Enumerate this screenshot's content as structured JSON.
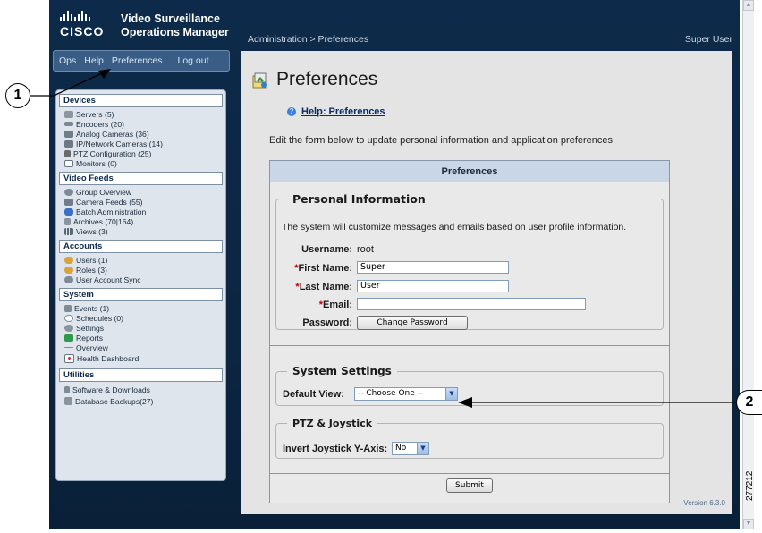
{
  "header": {
    "brand_word": "CISCO",
    "app_title_line1": "Video Surveillance",
    "app_title_line2": "Operations Manager",
    "breadcrumb": "Administration > Preferences",
    "user": "Super User"
  },
  "topnav": [
    "Ops",
    "Help",
    "Preferences",
    "Log out"
  ],
  "sidebar": {
    "sections": [
      {
        "title": "Devices",
        "items": [
          {
            "label": "Servers (5)",
            "icon": "server-icon",
            "color": "#8c96a3"
          },
          {
            "label": "Encoders (20)",
            "icon": "encoder-icon",
            "color": "#7d8894"
          },
          {
            "label": "Analog Cameras (36)",
            "icon": "analog-camera-icon",
            "color": "#6f7c8a"
          },
          {
            "label": "IP/Network Cameras (14)",
            "icon": "ip-camera-icon",
            "color": "#6c7886"
          },
          {
            "label": "PTZ Configuration (25)",
            "icon": "ptz-icon",
            "color": "#6a6a6a"
          },
          {
            "label": "Monitors (0)",
            "icon": "monitor-icon",
            "color": "#8e98a5"
          }
        ]
      },
      {
        "title": "Video Feeds",
        "items": [
          {
            "label": "Group Overview",
            "icon": "group-overview-icon",
            "color": "#7f8a98"
          },
          {
            "label": "Camera Feeds (55)",
            "icon": "camera-feeds-icon",
            "color": "#707c8a"
          },
          {
            "label": "Batch Administration",
            "icon": "batch-icon",
            "color": "#3a6fc8"
          },
          {
            "label": "Archives (70|164)",
            "icon": "archive-icon",
            "color": "#8a94a0"
          },
          {
            "label": "Views (3)",
            "icon": "views-icon",
            "color": "#8a94a0"
          }
        ]
      },
      {
        "title": "Accounts",
        "items": [
          {
            "label": "Users (1)",
            "icon": "users-icon",
            "color": "#d9a23a"
          },
          {
            "label": "Roles (3)",
            "icon": "roles-icon",
            "color": "#d9a23a"
          },
          {
            "label": "User Account Sync",
            "icon": "account-sync-icon",
            "color": "#7f8a98"
          }
        ]
      },
      {
        "title": "System",
        "items": [
          {
            "label": "Events (1)",
            "icon": "events-icon",
            "color": "#7f8a98"
          },
          {
            "label": "Schedules (0)",
            "icon": "schedules-icon",
            "color": "#8a94a0"
          },
          {
            "label": "Settings",
            "icon": "settings-icon",
            "color": "#8a94a0"
          },
          {
            "label": "Reports",
            "icon": "reports-icon",
            "color": "#2f9a4a"
          },
          {
            "label": "Overview",
            "icon": "overview-icon",
            "color": "#9aa3ae"
          },
          {
            "label": "Health Dashboard",
            "icon": "health-icon",
            "color": "#c83a3a"
          }
        ]
      },
      {
        "title": "Utilities",
        "items": [
          {
            "label": "Software & Downloads",
            "icon": "download-icon",
            "color": "#7f8a98"
          },
          {
            "label": "Database Backups(27)",
            "icon": "backup-icon",
            "color": "#8a94a0"
          }
        ]
      }
    ]
  },
  "main": {
    "title": "Preferences",
    "help_link": "Help: Preferences",
    "intro": "Edit the form below to update personal information and application preferences.",
    "panel_title": "Preferences",
    "personal": {
      "legend": "Personal Information",
      "description": "The system will customize messages and emails based on user profile information.",
      "username_label": "Username:",
      "username_value": "root",
      "required_mark": "*",
      "first_name_label": "First Name:",
      "first_name_value": "Super",
      "last_name_label": "Last Name:",
      "last_name_value": "User",
      "email_label": "Email:",
      "email_value": "",
      "password_label": "Password:",
      "change_password_button": "Change Password"
    },
    "system": {
      "legend": "System Settings",
      "default_view_label": "Default View:",
      "default_view_value": "-- Choose One --"
    },
    "ptz": {
      "legend": "PTZ & Joystick",
      "invert_label": "Invert Joystick Y-Axis:",
      "invert_value": "No"
    },
    "submit_button": "Submit",
    "version": "Version 6.3.0"
  },
  "callouts": {
    "one": "1",
    "two": "2"
  },
  "figure_id": "277212"
}
